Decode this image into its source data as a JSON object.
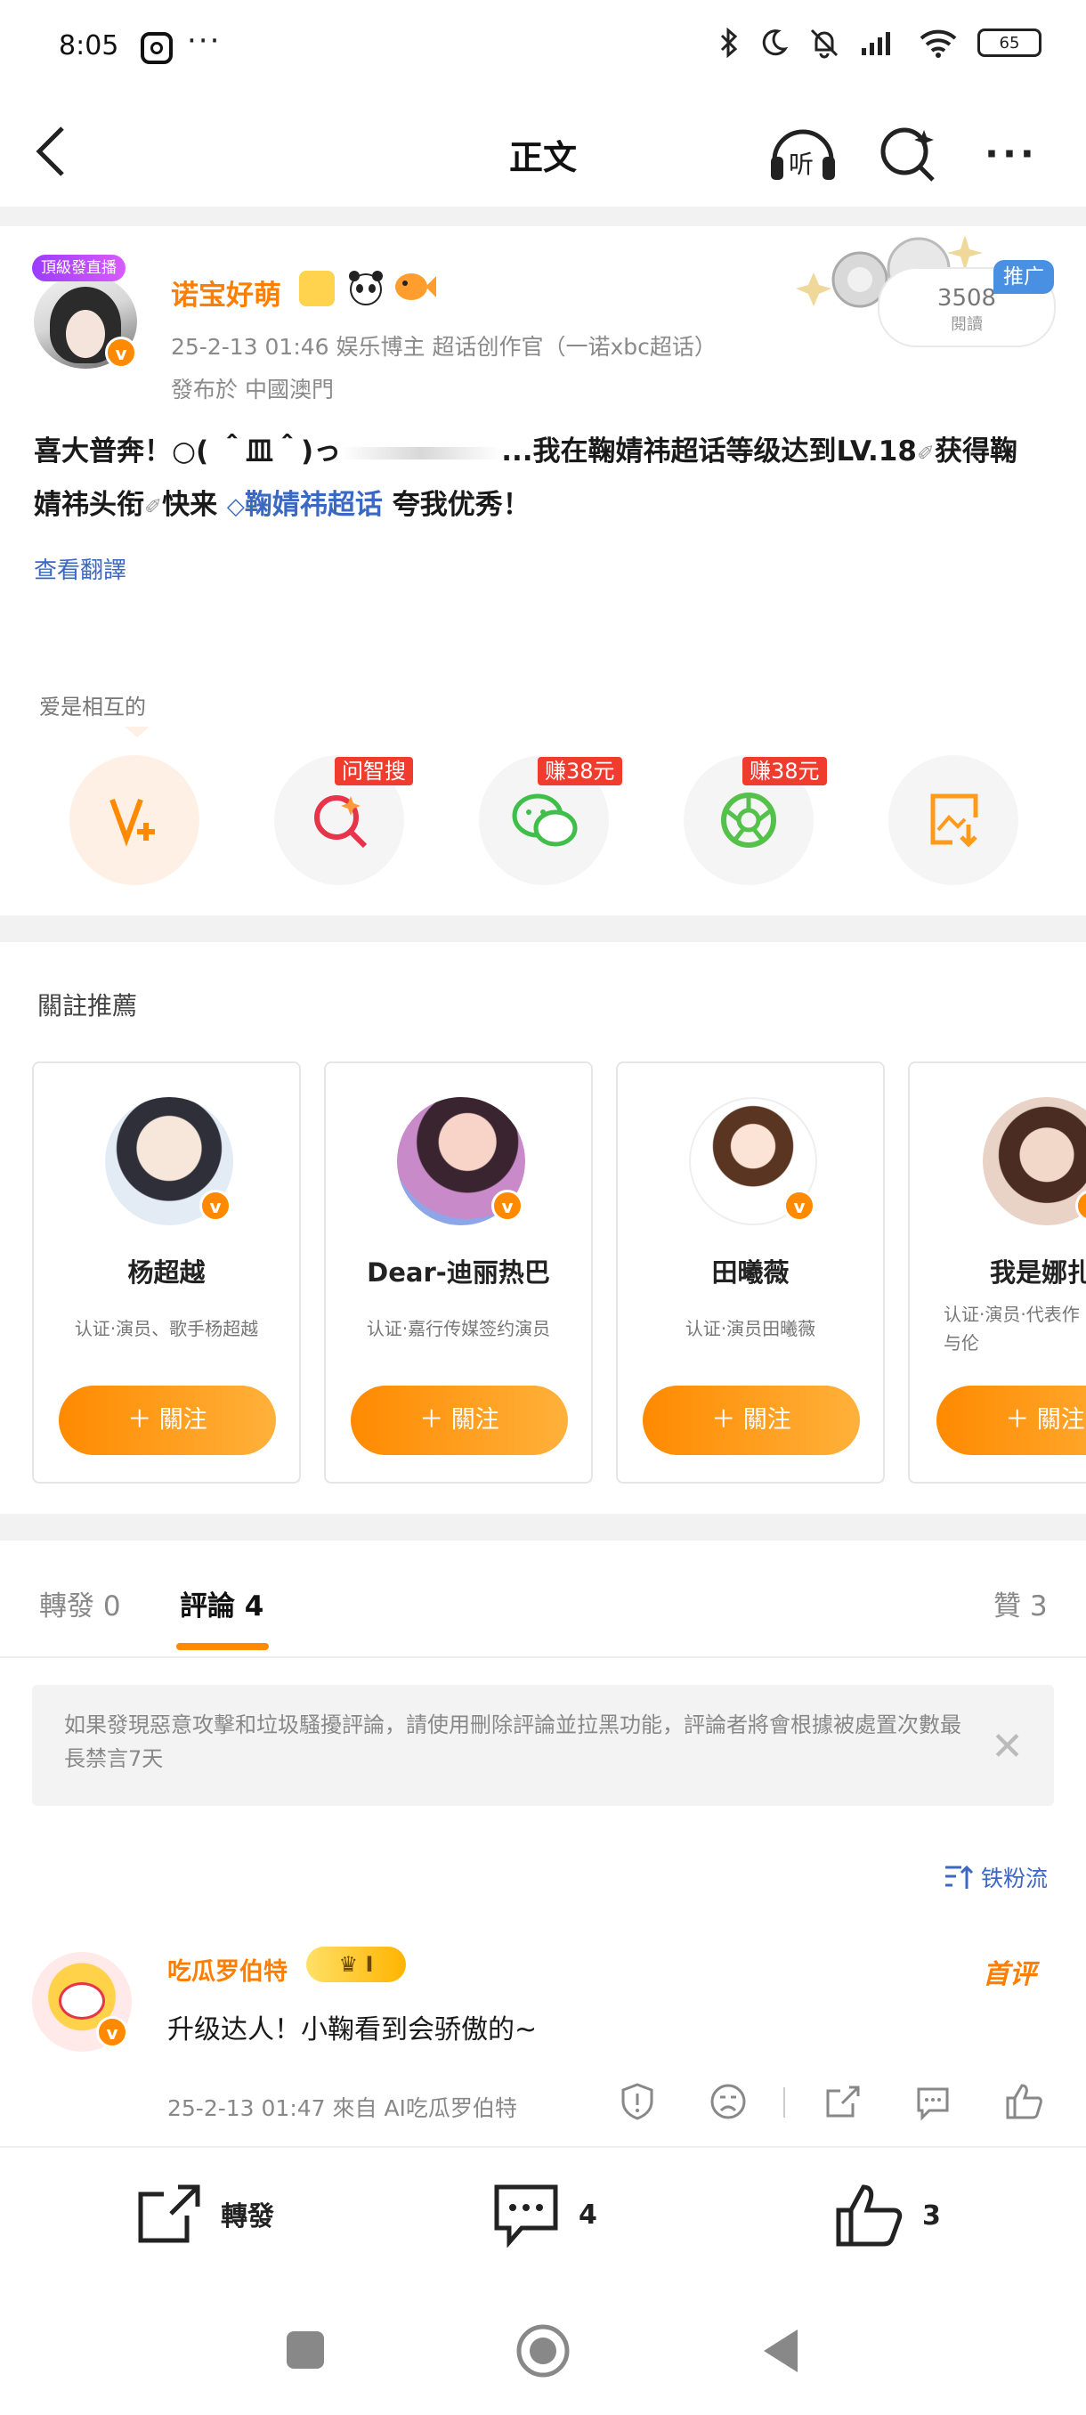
{
  "status_bar": {
    "time": "8:05",
    "more_dots": "···",
    "battery": "65"
  },
  "nav": {
    "title": "正文"
  },
  "post": {
    "live_badge": "頂級發直播",
    "author": "诺宝好萌",
    "meta_line": "25-2-13 01:46   娱乐博主 超话创作官（一诺xbc超话）",
    "location": "發布於 中國澳門",
    "read_count": "3508",
    "read_label": "閱讀",
    "promo_tag": "推广",
    "text_before": "喜大普奔！○( ＾皿＾)っ",
    "text_mid": "...我在鞠婧祎超话等级达到LV.18",
    "text_line2": "婧祎头衔",
    "text_quick": "快来",
    "topic_link": "鞠婧祎超话",
    "text_end": "夸我优秀！",
    "get_label": "获得鞠",
    "translate": "查看翻譯"
  },
  "interactions": {
    "label": "爱是相互的",
    "badges": [
      "问智搜",
      "赚38元",
      "赚38元"
    ]
  },
  "recommend": {
    "title": "關註推薦",
    "follow_label": "關注",
    "cards": [
      {
        "name": "杨超越",
        "desc": "认证·演员、歌手杨超越"
      },
      {
        "name": "Dear-迪丽热巴",
        "desc": "认证·嘉行传媒签约演员"
      },
      {
        "name": "田曦薇",
        "desc": "认证·演员田曦薇"
      },
      {
        "name": "我是娜扎",
        "desc": "认证·演员·代表作《茗茶骨》《无与伦"
      }
    ]
  },
  "tabs": {
    "repost": "轉發 0",
    "comments": "評論 4",
    "likes": "贊 3"
  },
  "notice": {
    "text": "如果發現惡意攻擊和垃圾騷擾評論，請使用刪除評論並拉黑功能，評論者將會根據被處置次數最長禁言7天"
  },
  "sort": {
    "label": "铁粉流"
  },
  "comment": {
    "author": "吃瓜罗伯特",
    "rank": "I",
    "text": "升级达人！小鞠看到会骄傲的~",
    "first_tag": "首评",
    "meta": "25-2-13 01:47  來自 AI吃瓜罗伯特"
  },
  "bottom_bar": {
    "repost": "轉發",
    "comments": "4",
    "likes": "3"
  }
}
